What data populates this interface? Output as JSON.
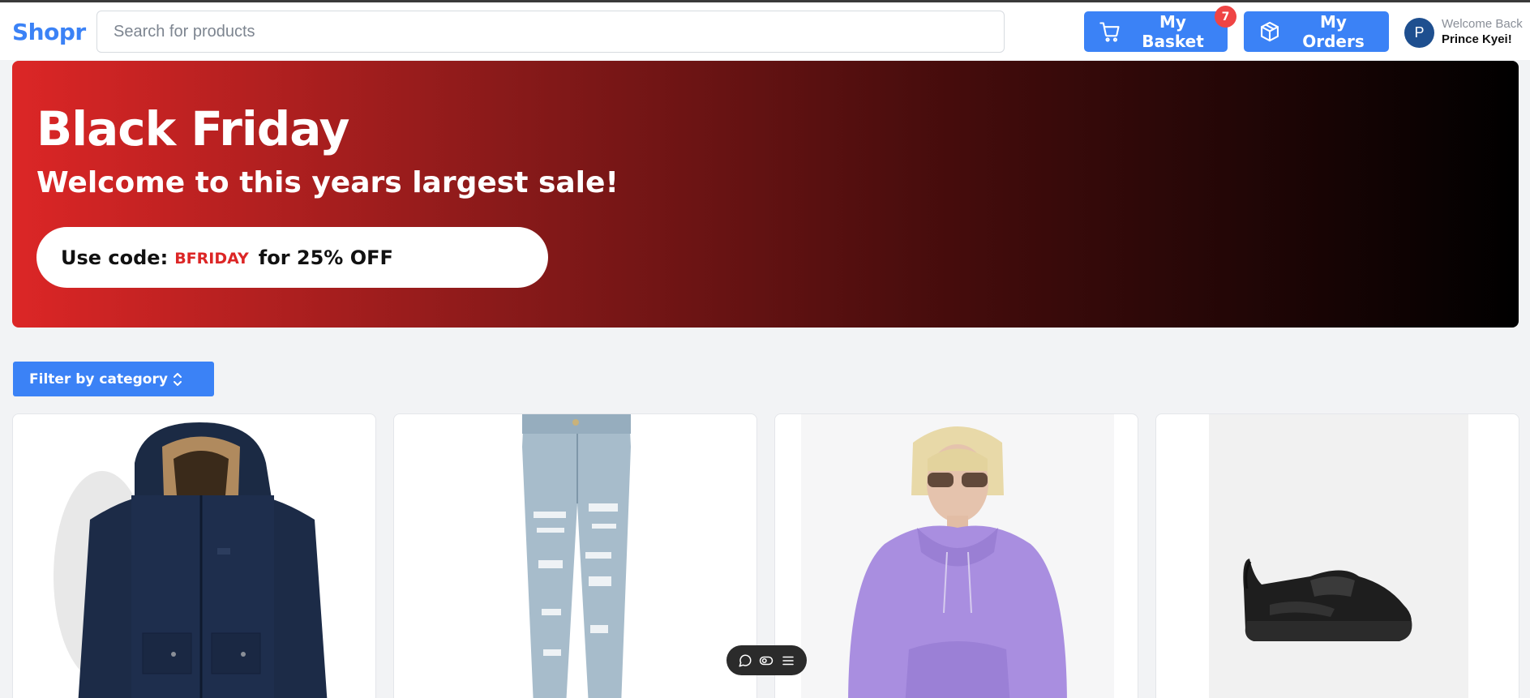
{
  "header": {
    "logo": "Shopr",
    "search_placeholder": "Search for products",
    "basket_label": "My Basket",
    "basket_count": "7",
    "orders_label": "My Orders",
    "avatar_initial": "P",
    "welcome_line": "Welcome Back",
    "user_name": "Prince Kyei!"
  },
  "banner": {
    "title": "Black Friday",
    "subtitle": "Welcome to this years largest sale!",
    "code_prefix": "Use code:",
    "code": "BFRIDAY",
    "code_suffix": "for 25% OFF"
  },
  "filter": {
    "label": "Filter by category"
  },
  "products": [
    {
      "image": "navy-parka-jacket"
    },
    {
      "image": "distressed-light-blue-jeans"
    },
    {
      "image": "lavender-hoodie-model"
    },
    {
      "image": "black-chunky-sneaker"
    }
  ],
  "floating_toolbar": {
    "icons": [
      "comment-icon",
      "toggle-view-icon",
      "menu-icon"
    ]
  },
  "colors": {
    "accent": "#3b82f6",
    "badge": "#ef4444",
    "sale_red": "#dc2626"
  }
}
